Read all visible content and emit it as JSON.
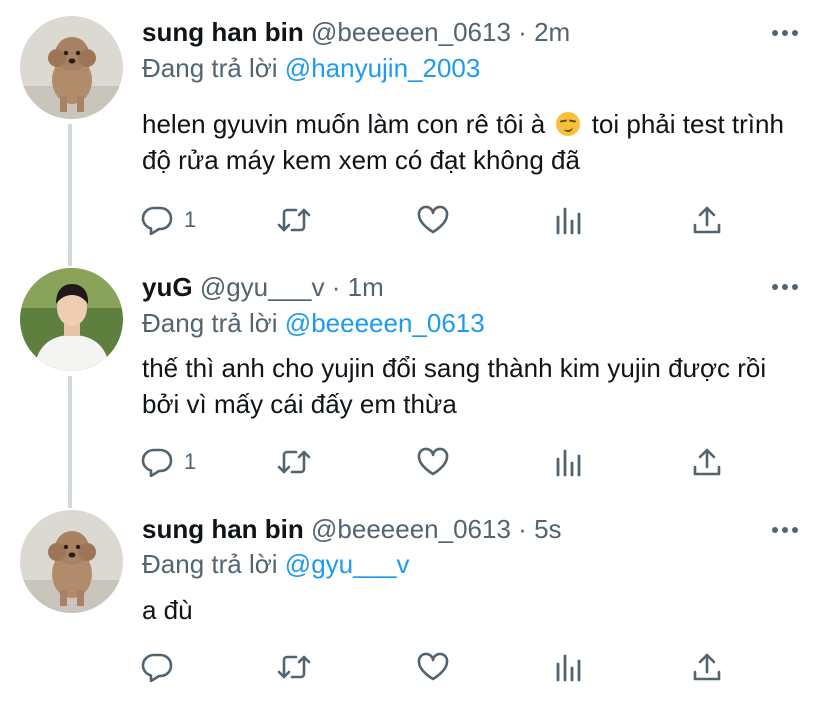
{
  "tweets": [
    {
      "name": "sung han bin",
      "handle": "@beeeeen_0613",
      "dot": "·",
      "time": "2m",
      "reply_prefix": "Đang trả lời",
      "reply_to": "@hanyujin_2003",
      "text_part1": "helen gyuvin muốn làm con rê tôi à",
      "emoji": "smirk-emoji",
      "text_part2": " toi phải test trình độ rửa máy kem xem có đạt không đã",
      "reply_count": "1"
    },
    {
      "name": "yuG",
      "handle": "@gyu___v",
      "dot": "·",
      "time": "1m",
      "reply_prefix": "Đang trả lời",
      "reply_to": "@beeeeen_0613",
      "text": "thế thì anh cho yujin đổi sang thành kim yujin được rồi bởi vì mấy cái đấy em thừa",
      "reply_count": "1"
    },
    {
      "name": "sung han bin",
      "handle": "@beeeeen_0613",
      "dot": "·",
      "time": "5s",
      "reply_prefix": "Đang trả lời",
      "reply_to": "@gyu___v",
      "text": "a đù",
      "reply_count": ""
    }
  ],
  "colors": {
    "text": "#0f1419",
    "secondary": "#536471",
    "link": "#1d9bf0",
    "thread_line": "#cfd9de"
  },
  "icons": [
    "reply-icon",
    "retweet-icon",
    "like-icon",
    "analytics-icon",
    "share-icon",
    "more-icon"
  ]
}
